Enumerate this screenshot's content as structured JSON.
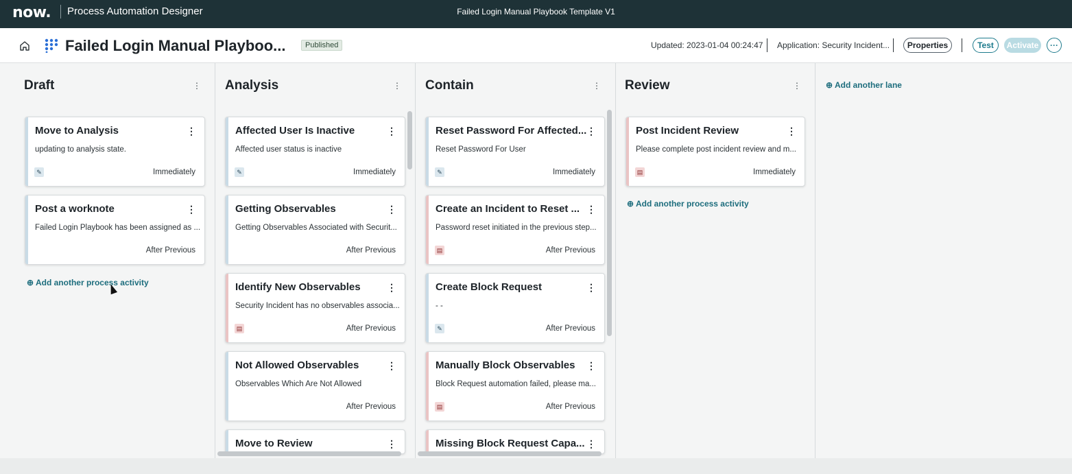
{
  "topbar": {
    "logo": "now.",
    "app_name": "Process Automation Designer",
    "window_title": "Failed Login Manual Playbook Template V1"
  },
  "header": {
    "title": "Failed Login Manual Playboo...",
    "status_badge": "Published",
    "updated": "Updated:  2023-01-04 00:24:47",
    "application": "Application: Security Incident...",
    "properties_label": "Properties",
    "test_label": "Test",
    "activate_label": "Activate",
    "more_label": "···"
  },
  "lanes": [
    {
      "title": "Draft",
      "cards": [
        {
          "title": "Move to Analysis",
          "desc": "updating to analysis state.",
          "timing": "Immediately",
          "icon": "edit-icon",
          "accent": "#c9dbe6"
        },
        {
          "title": "Post a worknote",
          "desc": "Failed Login Playbook has been assigned as ...",
          "timing": "After Previous",
          "icon": "",
          "accent": "#c9dbe6"
        }
      ],
      "add_activity": "Add another process activity"
    },
    {
      "title": "Analysis",
      "cards": [
        {
          "title": "Affected User Is Inactive",
          "desc": "Affected user status is inactive",
          "timing": "Immediately",
          "icon": "edit-icon",
          "accent": "#c9dbe6"
        },
        {
          "title": "Getting Observables",
          "desc": "Getting Observables Associated with Securit...",
          "timing": "After Previous",
          "icon": "",
          "accent": "#c9dbe6"
        },
        {
          "title": "Identify New Observables",
          "desc": "Security Incident has no observables associa...",
          "timing": "After Previous",
          "icon": "task-icon",
          "accent": "#eac4c4"
        },
        {
          "title": "Not Allowed Observables",
          "desc": "Observables Which Are Not Allowed",
          "timing": "After Previous",
          "icon": "",
          "accent": "#c9dbe6"
        },
        {
          "title": "Move to Review",
          "desc": "",
          "timing": "",
          "icon": "",
          "accent": "#c9dbe6"
        }
      ]
    },
    {
      "title": "Contain",
      "cards": [
        {
          "title": "Reset Password For Affected...",
          "desc": "Reset Password For User",
          "timing": "Immediately",
          "icon": "edit-icon",
          "accent": "#c9dbe6"
        },
        {
          "title": "Create an Incident to Reset ...",
          "desc": "Password reset initiated in the previous step...",
          "timing": "After Previous",
          "icon": "task-icon",
          "accent": "#eac4c4"
        },
        {
          "title": "Create Block Request",
          "desc": "- -",
          "timing": "After Previous",
          "icon": "edit-icon",
          "accent": "#c9dbe6"
        },
        {
          "title": "Manually Block Observables",
          "desc": "Block Request automation failed, please ma...",
          "timing": "After Previous",
          "icon": "task-icon",
          "accent": "#eac4c4"
        },
        {
          "title": "Missing Block Request Capa...",
          "desc": "",
          "timing": "",
          "icon": "",
          "accent": "#eac4c4"
        }
      ]
    },
    {
      "title": "Review",
      "cards": [
        {
          "title": "Post Incident Review",
          "desc": "Please complete post incident review and m...",
          "timing": "Immediately",
          "icon": "task-icon",
          "accent": "#eac4c4"
        }
      ],
      "add_activity": "Add another process activity"
    }
  ],
  "add_lane": "Add another lane",
  "icons": {
    "kebab": "⋮",
    "lane_kebab": "⋮",
    "plus": "⊕",
    "edit": "✎",
    "task": "▤"
  }
}
